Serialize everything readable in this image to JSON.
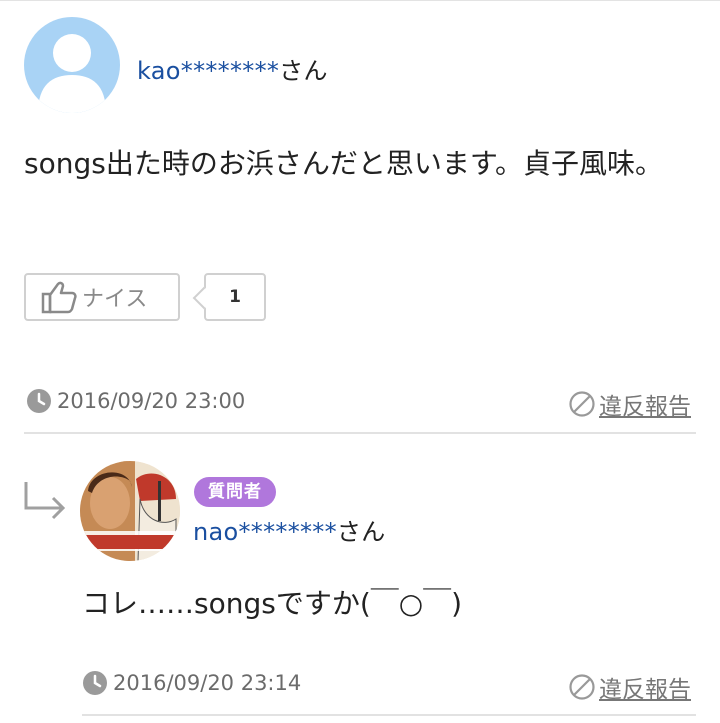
{
  "answer": {
    "username": "kao********",
    "username_suffix": "さん",
    "avatar_icon": "default-user-avatar-icon",
    "text": "songs出た時のお浜さんだと思います。貞子風味。",
    "like_label": "ナイス",
    "like_count": "1",
    "timestamp": "2016/09/20 23:00",
    "report_label": "違反報告"
  },
  "reply": {
    "badge": "質問者",
    "username": "nao********",
    "username_suffix": "さん",
    "avatar_icon": "profile-photo-avatar",
    "text": "コレ……songsですか(￣○￣)",
    "timestamp": "2016/09/20 23:14",
    "report_label": "違反報告"
  },
  "colors": {
    "username": "#1a4fa0",
    "badge": "#b077dc",
    "avatar_bg": "#a9d3f5",
    "meta_gray": "#6b6b6b"
  }
}
